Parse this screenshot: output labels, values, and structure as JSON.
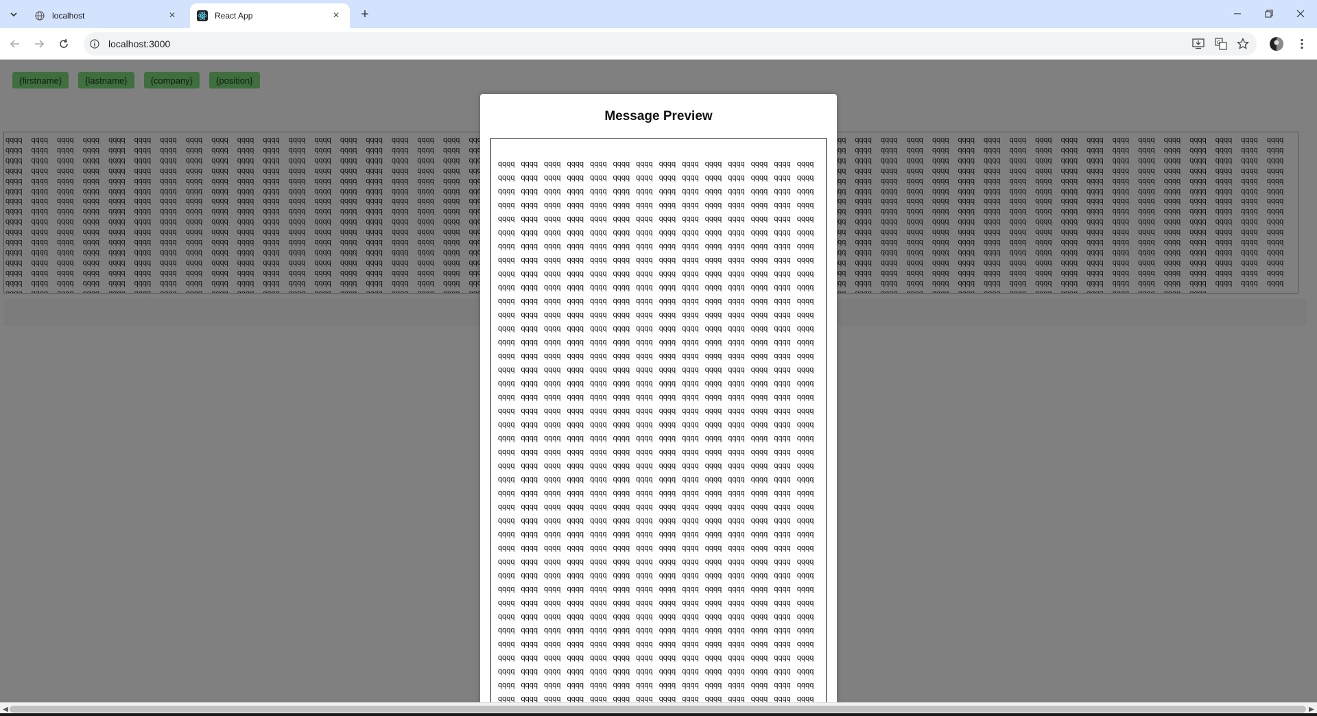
{
  "browser": {
    "tabs": [
      {
        "title": "localhost",
        "active": false
      },
      {
        "title": "React App",
        "active": true
      }
    ],
    "url": "localhost:3000"
  },
  "page": {
    "tokens": [
      "{firstname}",
      "{lastname}",
      "{company}",
      "{position}"
    ],
    "editor_word": "qqqq",
    "editor_word_count": 797
  },
  "modal": {
    "title": "Message Preview",
    "preview_word": "qqqq",
    "preview_line_count": 40,
    "preview_words_per_line": 14
  },
  "colors": {
    "overlay": "#808080",
    "token_bg": "#3f6e3f",
    "tabstrip": "#d3e3fd"
  }
}
